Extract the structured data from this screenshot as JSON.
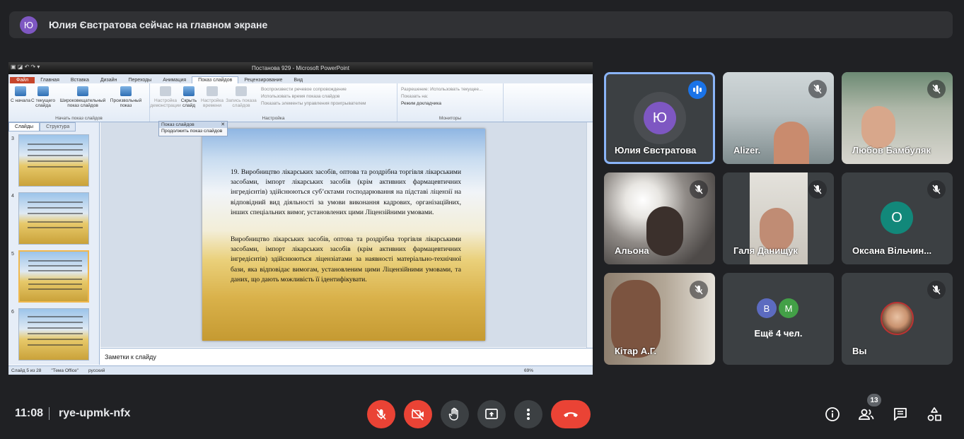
{
  "banner": {
    "avatar_letter": "Ю",
    "text": "Юлия Євстратова сейчас на главном экране"
  },
  "ppt": {
    "title": "Постанова 929 - Microsoft PowerPoint",
    "tabs": [
      "Файл",
      "Главная",
      "Вставка",
      "Дизайн",
      "Переходы",
      "Анимация",
      "Показ слайдов",
      "Рецензирование",
      "Вид"
    ],
    "ribbon": {
      "btn_start": "С начала",
      "btn_current": "С текущего слайда",
      "btn_wide": "Широковещательный показ слайдов",
      "btn_custom": "Произвольный показ",
      "group1": "Начать показ слайдов",
      "btn_setup": "Настройка демонстрации",
      "btn_hide": "Скрыть слайд",
      "btn_timing": "Настройка времени",
      "btn_record": "Запись показа слайдов",
      "chk1": "Воспроизвести речевое сопровождение",
      "chk2": "Использовать время показа слайдов",
      "chk3": "Показать элементы управления проигрывателем",
      "group2": "Настройка",
      "res_label": "Разрешение:",
      "res_value": "Использовать текущее...",
      "show_on": "Показать на:",
      "presenter": "Режим докладчика",
      "group3": "Мониторы"
    },
    "pane_tabs": [
      "Слайды",
      "Структура"
    ],
    "thumb_nums": [
      "3",
      "4",
      "5",
      "6"
    ],
    "float_title": "Показ слайдов",
    "float_item": "Продолжить показ слайдов",
    "slide_p1": "19. Виробництво лікарських засобів, оптова та роздрібна торгівля лікарськими засобами, імпорт лікарських засобів (крім активних фармацевтичних інгредієнтів) здійснюються суб’єктами господарювання на підставі ліцензії на відповідний вид діяльності за умови виконання кадрових, організаційних, інших спеціальних вимог, установлених цими Ліцензійними умовами.",
    "slide_p2": "Виробництво лікарських засобів, оптова та роздрібна торгівля лікарськими засобами, імпорт лікарських засобів (крім активних фармацевтичних інгредієнтів) здійснюються ліцензіатами за наявності матеріально-технічної бази, яка відповідає вимогам, установленим цими Ліцензійними умовами, та даних, що дають можливість її ідентифікувати.",
    "notes": "Заметки к слайду",
    "status_slide": "Слайд 5 из 28",
    "status_theme": "\"Тема Office\"",
    "status_lang": "русский",
    "zoom": "69%"
  },
  "participants": [
    {
      "name": "Юлия Євстратова",
      "letter": "Ю",
      "color": "#7e57c2",
      "speaking": true
    },
    {
      "name": "Alizer.",
      "muted": true
    },
    {
      "name": "Любов Бамбуляк",
      "muted": true
    },
    {
      "name": "Альона",
      "muted": true
    },
    {
      "name": "Галя Данищук",
      "muted": true
    },
    {
      "name": "Оксана Вільчин...",
      "letter": "О",
      "color": "#12887a",
      "muted": true
    },
    {
      "name": "Кітар А.Г.",
      "muted": true
    },
    {
      "name": "Ещё 4 чел.",
      "letters": [
        "В",
        "М"
      ],
      "colors": [
        "#5c6bc0",
        "#43a047"
      ]
    },
    {
      "name": "Вы",
      "muted": true
    }
  ],
  "bottom": {
    "time": "11:08",
    "meeting_code": "rye-upmk-nfx",
    "people_count": "13"
  }
}
